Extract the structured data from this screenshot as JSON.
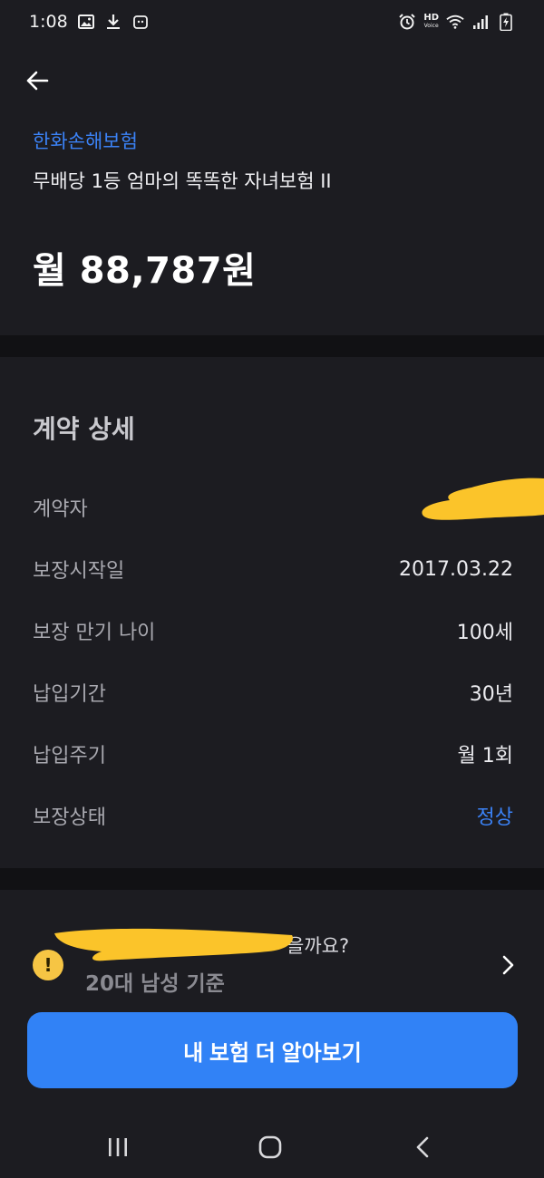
{
  "status_bar": {
    "time": "1:08",
    "hd_label": "HD",
    "voice_label": "Voice"
  },
  "header": {
    "insurer": "한화손해보험",
    "product": "무배당 1등 엄마의 똑똑한 자녀보험 II",
    "premium": "월 88,787원"
  },
  "details": {
    "title": "계약 상세",
    "rows": [
      {
        "label": "계약자",
        "value": ""
      },
      {
        "label": "보장시작일",
        "value": "2017.03.22"
      },
      {
        "label": "보장 만기 나이",
        "value": "100세"
      },
      {
        "label": "납입기간",
        "value": "30년"
      },
      {
        "label": "납입주기",
        "value": "월 1회"
      },
      {
        "label": "보장상태",
        "value": "정상"
      }
    ]
  },
  "info": {
    "question_suffix": "을까요?",
    "subtitle": "20대 남성 기준"
  },
  "cta": {
    "label": "내 보험 더 알아보기"
  },
  "colors": {
    "accent": "#3182f6",
    "status": "#3b82f6",
    "warning": "#f6c544",
    "redaction": "#fbc42a"
  }
}
